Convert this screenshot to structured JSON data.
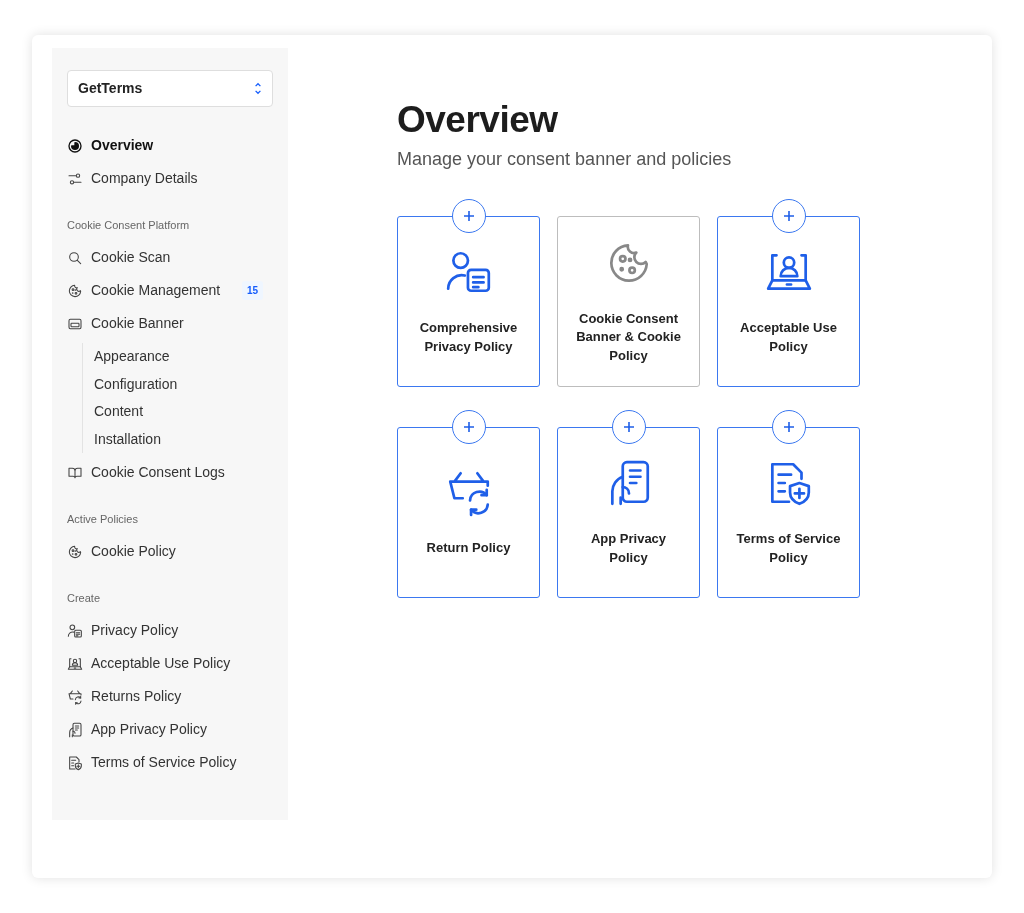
{
  "sidebar": {
    "workspace": {
      "label": "GetTerms"
    },
    "sections": [
      {
        "items": [
          {
            "label": "Overview",
            "kind": "overview",
            "selected": true
          },
          {
            "label": "Company Details",
            "kind": "sliders",
            "selected": false
          }
        ]
      },
      {
        "heading": "Cookie Consent Platform",
        "items": [
          {
            "label": "Cookie Scan",
            "kind": "search",
            "selected": false
          },
          {
            "label": "Cookie Management",
            "kind": "cookie",
            "selected": false,
            "badge": "15"
          },
          {
            "label": "Cookie Banner",
            "kind": "banner",
            "selected": false,
            "children": [
              {
                "label": "Appearance",
                "selected": false
              },
              {
                "label": "Configuration",
                "selected": false
              },
              {
                "label": "Content",
                "selected": false
              },
              {
                "label": "Installation",
                "selected": false
              }
            ]
          },
          {
            "label": "Cookie Consent Logs",
            "kind": "book",
            "selected": false
          }
        ]
      },
      {
        "heading": "Active Policies",
        "items": [
          {
            "label": "Cookie Policy",
            "kind": "cookie",
            "selected": false
          }
        ]
      },
      {
        "heading": "Create",
        "items": [
          {
            "label": "Privacy Policy",
            "kind": "person-doc",
            "selected": false
          },
          {
            "label": "Acceptable Use Policy",
            "kind": "laptop-user",
            "selected": false
          },
          {
            "label": "Returns Policy",
            "kind": "basket",
            "selected": false
          },
          {
            "label": "App Privacy Policy",
            "kind": "phone-hand",
            "selected": false
          },
          {
            "label": "Terms of Service Policy",
            "kind": "doc-shield",
            "selected": false
          }
        ]
      }
    ]
  },
  "main": {
    "title": "Overview",
    "subtitle": "Manage your consent banner and policies",
    "cards": [
      {
        "title": "Comprehensive Privacy Policy",
        "kind": "person-doc",
        "addable": true
      },
      {
        "title": "Cookie Consent Banner & Cookie Policy",
        "kind": "cookie",
        "addable": false
      },
      {
        "title": "Acceptable Use Policy",
        "kind": "laptop-user",
        "addable": true
      },
      {
        "title": "Return Policy",
        "kind": "basket",
        "addable": true
      },
      {
        "title": "App Privacy Policy",
        "kind": "phone-hand",
        "addable": true
      },
      {
        "title": "Terms of Service Policy",
        "kind": "doc-shield",
        "addable": true
      }
    ]
  }
}
